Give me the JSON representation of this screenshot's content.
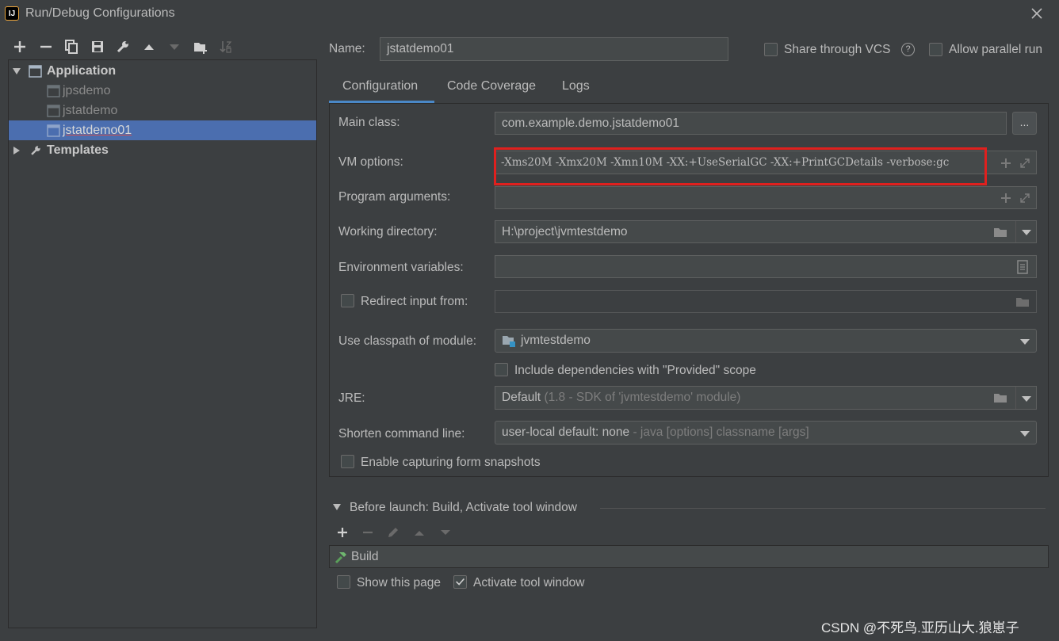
{
  "window": {
    "title": "Run/Debug Configurations",
    "logo_text": "IJ"
  },
  "tree": {
    "application": "Application",
    "items": [
      "jpsdemo",
      "jstatdemo",
      "jstatdemo01"
    ],
    "templates": "Templates"
  },
  "header": {
    "name_label": "Name:",
    "name_value": "jstatdemo01",
    "share_vcs": "Share through VCS",
    "allow_parallel": "Allow parallel run",
    "help_glyph": "?"
  },
  "tabs": [
    "Configuration",
    "Code Coverage",
    "Logs"
  ],
  "form": {
    "main_class_label": "Main class:",
    "main_class_value": "com.example.demo.jstatdemo01",
    "browse_button": "...",
    "vm_options_label": "VM options:",
    "vm_options_value": "-Xms20M -Xmx20M -Xmn10M -XX:+UseSerialGC -XX:+PrintGCDetails -verbose:gc",
    "program_args_label": "Program arguments:",
    "working_dir_label": "Working directory:",
    "working_dir_value": "H:\\project\\jvmtestdemo",
    "env_vars_label": "Environment variables:",
    "redirect_label": "Redirect input from:",
    "classpath_label": "Use classpath of module:",
    "classpath_value": "jvmtestdemo",
    "include_deps_label": "Include dependencies with \"Provided\" scope",
    "jre_label": "JRE:",
    "jre_value": "Default",
    "jre_hint": "(1.8 - SDK of 'jvmtestdemo' module)",
    "shorten_label": "Shorten command line:",
    "shorten_value": "user-local default: none",
    "shorten_hint": "- java [options] classname [args]",
    "capture_label": "Enable capturing form snapshots"
  },
  "before_launch": {
    "title": "Before launch: Build, Activate tool window",
    "task": "Build",
    "show_page": "Show this page",
    "activate_window": "Activate tool window"
  },
  "watermark": "CSDN @不死鸟.亚历山大.狼崽子",
  "colors": {
    "background": "#3c3f41",
    "selection": "#4b6eaf",
    "highlight_box": "#e0201e",
    "tab_underline": "#4a88c7"
  }
}
